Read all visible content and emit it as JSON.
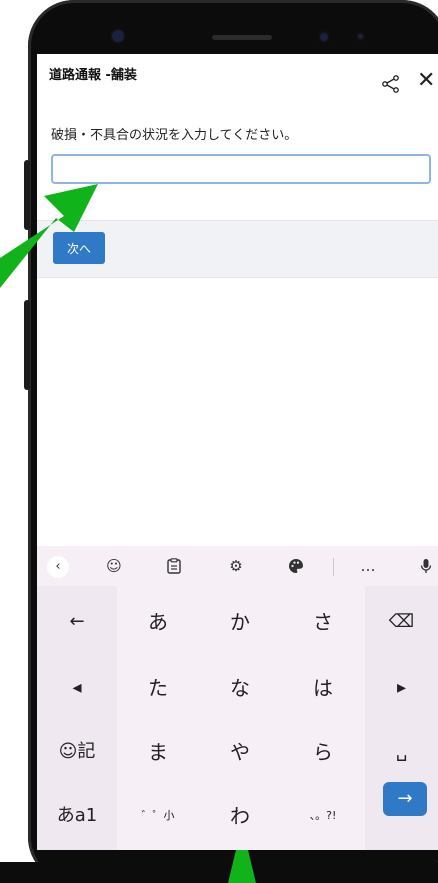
{
  "app": {
    "title": "道路通報 -舗装",
    "share_icon": "share-icon",
    "close_icon": "✕"
  },
  "form": {
    "prompt": "破損・不具合の状況を入力してください。",
    "input_value": "",
    "input_placeholder": "",
    "next_label": "次へ"
  },
  "keyboard": {
    "toolbar": {
      "back": "‹",
      "items": [
        "☺",
        "📋",
        "⚙",
        "🎨",
        "…",
        "🎤"
      ]
    },
    "rows": [
      [
        "←",
        "あ",
        "か",
        "さ",
        "⌫"
      ],
      [
        "◂",
        "た",
        "な",
        "は",
        "▸"
      ],
      [
        "☺記",
        "ま",
        "や",
        "ら",
        "␣"
      ],
      [
        "あa1",
        "゛゜小",
        "わ",
        "、。?!",
        "→"
      ]
    ]
  },
  "colors": {
    "accent": "#2f79c6",
    "input_border": "#8fb4e6",
    "keyboard_bg": "#f6f0f6",
    "arrow_green": "#11b31a"
  }
}
